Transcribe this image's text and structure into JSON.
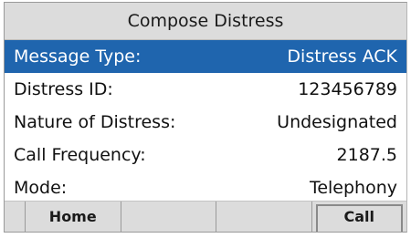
{
  "title": "Compose Distress",
  "rows": [
    {
      "label": "Message Type:",
      "value": "Distress ACK",
      "selected": true
    },
    {
      "label": "Distress ID:",
      "value": "123456789",
      "selected": false
    },
    {
      "label": "Nature of Distress:",
      "value": "Undesignated",
      "selected": false
    },
    {
      "label": "Call Frequency:",
      "value": "2187.5",
      "selected": false
    },
    {
      "label": "Mode:",
      "value": "Telephony",
      "selected": false
    }
  ],
  "softkeys": {
    "key1": "",
    "key2": "Home",
    "key3": "",
    "key4": "",
    "key5": "Call"
  },
  "colors": {
    "selection": "#1f65ae",
    "title_bg": "#dcdcdc"
  }
}
